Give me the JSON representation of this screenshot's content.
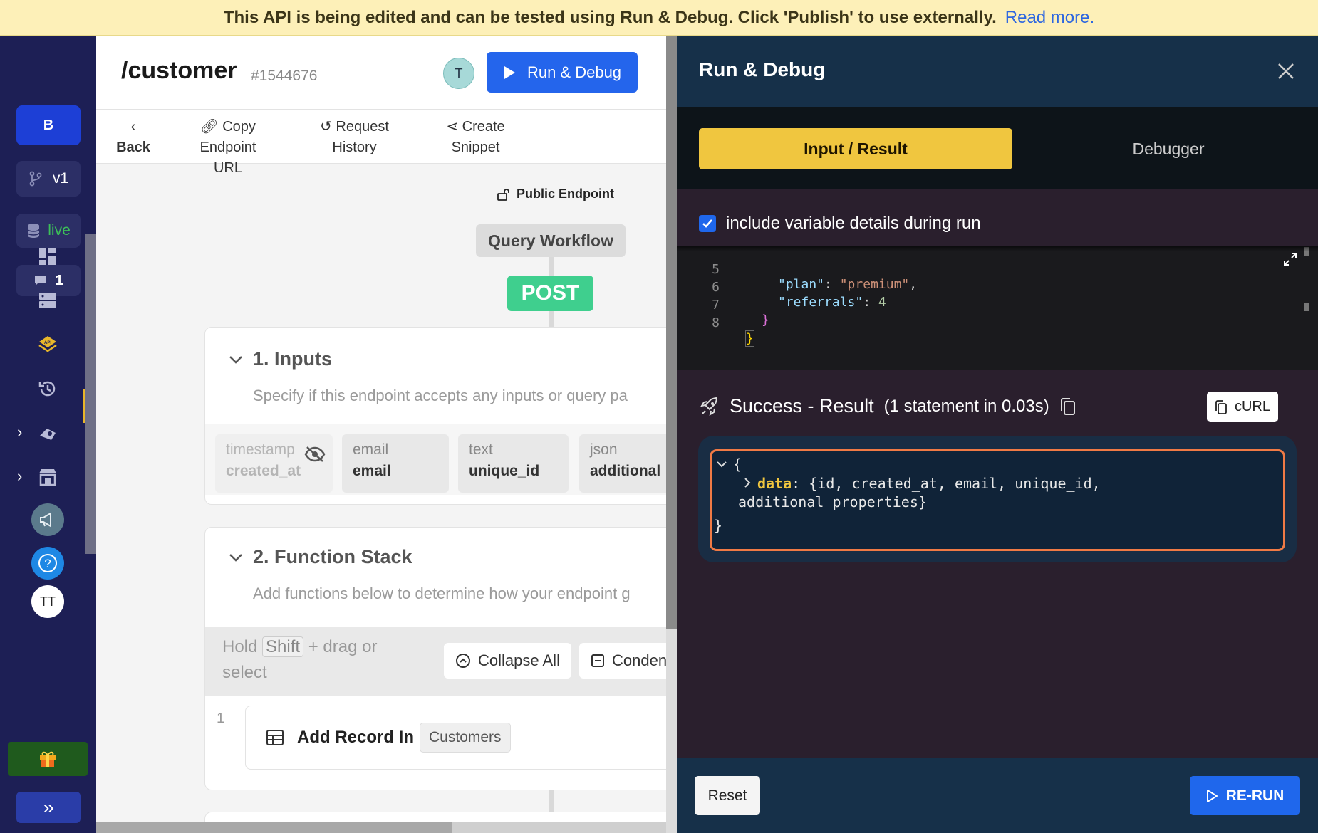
{
  "banner": {
    "message": "This API is being edited and can be tested using Run & Debug. Click 'Publish' to use externally.",
    "link": "Read more."
  },
  "rail": {
    "brand": "B",
    "version": "v1",
    "env": "live",
    "comments": "1",
    "avatar": "TT"
  },
  "editor": {
    "title": "/customer",
    "id": "#1544676",
    "avatar": "T",
    "run_button": "Run & Debug",
    "toolbar": {
      "back": "Back",
      "copy_line1": "Copy Endpoint",
      "copy_line2": "URL",
      "history_line1": "Request",
      "history_line2": "History",
      "snippet_line1": "Create",
      "snippet_line2": "Snippet"
    },
    "public_endpoint": "Public Endpoint",
    "query_workflow": "Query Workflow",
    "method": "POST",
    "inputs": {
      "title": "1. Inputs",
      "subtitle": "Specify if this endpoint accepts any inputs or query pa",
      "fields": [
        {
          "type": "timestamp",
          "name": "created_at"
        },
        {
          "type": "email",
          "name": "email"
        },
        {
          "type": "text",
          "name": "unique_id"
        },
        {
          "type": "json",
          "name": "additional"
        }
      ]
    },
    "function_stack": {
      "title": "2. Function Stack",
      "subtitle": "Add functions below to determine how your endpoint g",
      "hold": "Hold",
      "shift": "Shift",
      "drag": "+ drag or",
      "select": "select",
      "collapse_all": "Collapse All",
      "condense": "Conden",
      "step_number": "1",
      "step_label": "Add Record In",
      "step_table": "Customers"
    }
  },
  "panel": {
    "title": "Run & Debug",
    "tab_active": "Input / Result",
    "tab_other": "Debugger",
    "checkbox_label": "include variable details during run",
    "code": {
      "line5_num": "5",
      "line5_key": "\"plan\"",
      "line5_val": "\"premium\"",
      "line6_num": "6",
      "line6_key": "\"referrals\"",
      "line6_val": "4",
      "line7_num": "7",
      "line7_text": "}",
      "line8_num": "8",
      "line8_text": "}"
    },
    "result": {
      "status": "Success - Result",
      "detail": "(1 statement in 0.03s)",
      "curl": "cURL",
      "open_brace": "{",
      "data_key": "data",
      "data_value_1": "{id, created_at, email, unique_id,",
      "data_value_2": "additional_properties}",
      "close_brace": "}"
    },
    "reset": "Reset",
    "rerun": "RE-RUN"
  },
  "colors": {
    "banner_bg": "#fdf0b8",
    "rail_bg": "#1d1f55",
    "accent_blue": "#2465ec",
    "tab_yellow": "#f0c63f",
    "post_green": "#3fcf8e",
    "result_border": "#f07a45"
  }
}
